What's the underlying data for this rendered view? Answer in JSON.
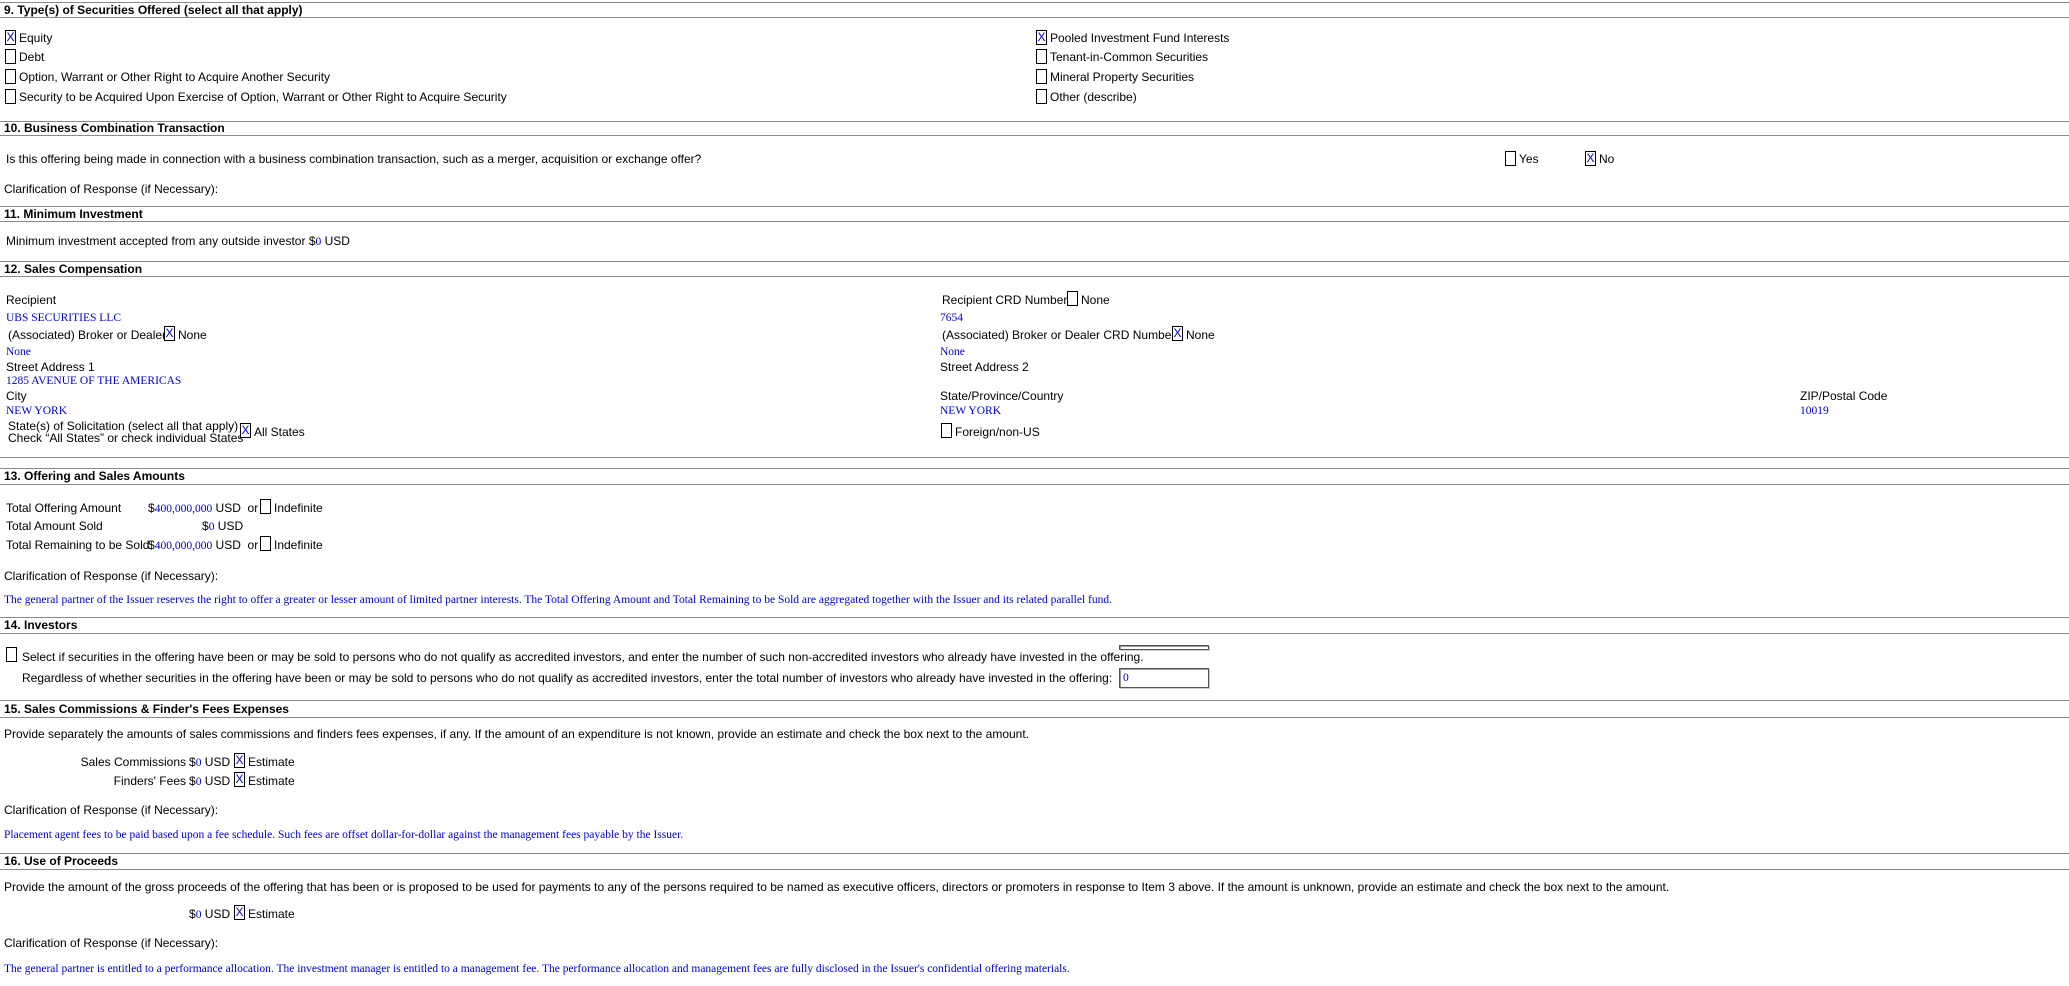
{
  "s9": {
    "heading": "9. Type(s) of Securities Offered (select all that apply)",
    "items": [
      {
        "label": "Equity",
        "mark": "X"
      },
      {
        "label": "Debt",
        "mark": ""
      },
      {
        "label": "Option, Warrant or Other Right to Acquire Another Security",
        "mark": ""
      },
      {
        "label": "Security to be Acquired Upon Exercise of Option, Warrant or Other Right to Acquire Security",
        "mark": ""
      },
      {
        "label": "Pooled Investment Fund Interests",
        "mark": "X"
      },
      {
        "label": "Tenant-in-Common Securities",
        "mark": ""
      },
      {
        "label": "Mineral Property Securities",
        "mark": ""
      },
      {
        "label": "Other (describe)",
        "mark": ""
      }
    ]
  },
  "s10": {
    "heading": "10. Business Combination Transaction",
    "question": "Is this offering being made in connection with a business combination transaction, such as a merger, acquisition or exchange offer?",
    "yes_label": "Yes",
    "yes_mark": "",
    "no_label": "No",
    "no_mark": "X",
    "clarification_label": "Clarification of Response (if Necessary):"
  },
  "s11": {
    "heading": "11. Minimum Investment",
    "label": "Minimum investment accepted from any outside investor",
    "currency_symbol": "$",
    "value": "0",
    "unit": "USD"
  },
  "s12": {
    "heading": "12. Sales Compensation",
    "recipient_label": "Recipient",
    "recipient_value": "UBS SECURITIES LLC",
    "crd_label": "Recipient CRD Number",
    "crd_none_mark": "",
    "none_label": "None",
    "crd_value": "7654",
    "bd_label": "(Associated) Broker or Dealer",
    "bd_none_mark": "X",
    "bd_value": "None",
    "bd_crd_label": "(Associated) Broker or Dealer CRD Number",
    "bd_crd_none_mark": "X",
    "bd_crd_value": "None",
    "street1_label": "Street Address 1",
    "street1_value": "1285 AVENUE OF THE AMERICAS",
    "street2_label": "Street Address 2",
    "city_label": "City",
    "city_value": "NEW YORK",
    "state_label": "State/Province/Country",
    "state_value": "NEW YORK",
    "zip_label": "ZIP/Postal Code",
    "zip_value": "10019",
    "solicitation_label1": "State(s) of Solicitation (select all that apply)",
    "solicitation_label2": "Check “All States” or check individual States",
    "all_states_label": "All States",
    "all_states_mark": "X",
    "foreign_label": "Foreign/non-US",
    "foreign_mark": ""
  },
  "s13": {
    "heading": "13. Offering and Sales Amounts",
    "total_offering_label": "Total Offering Amount",
    "total_offering_value": "400,000,000",
    "total_sold_label": "Total Amount Sold",
    "total_sold_value": "0",
    "total_remaining_label": "Total Remaining to be Sold",
    "total_remaining_value": "400,000,000",
    "currency_symbol": "$",
    "unit": "USD",
    "or_label": "or",
    "indefinite_label": "Indefinite",
    "clarification_label": "Clarification of Response (if Necessary):",
    "clarification_text": "The general partner of the Issuer reserves the right to offer a greater or lesser amount of limited partner interests. The Total Offering Amount and Total Remaining to be Sold are aggregated together with the Issuer and its related parallel fund."
  },
  "s14": {
    "heading": "14. Investors",
    "non_accredited_label": "Select if securities in the offering have been or may be sold to persons who do not qualify as accredited investors, and enter the number of such non-accredited investors who already have invested in the offering.",
    "total_label": "Regardless of whether securities in the offering have been or may be sold to persons who do not qualify as accredited investors, enter the total number of investors who already have invested in the offering:",
    "total_value": "0"
  },
  "s15": {
    "heading": "15. Sales Commissions & Finder's Fees Expenses",
    "intro": "Provide separately the amounts of sales commissions and finders fees expenses, if any. If the amount of an expenditure is not known, provide an estimate and check the box next to the amount.",
    "sales_label": "Sales Commissions",
    "sales_value": "0",
    "finders_label": "Finders' Fees",
    "finders_value": "0",
    "currency_symbol": "$",
    "unit": "USD",
    "estimate_label": "Estimate",
    "estimate_mark": "X",
    "clarification_label": "Clarification of Response (if Necessary):",
    "clarification_text": "Placement agent fees to be paid based upon a fee schedule. Such fees are offset dollar-for-dollar against the management fees payable by the Issuer."
  },
  "s16": {
    "heading": "16. Use of Proceeds",
    "intro": "Provide the amount of the gross proceeds of the offering that has been or is proposed to be used for payments to any of the persons required to be named as executive officers, directors or promoters in response to Item 3 above. If the amount is unknown, provide an estimate and check the box next to the amount.",
    "currency_symbol": "$",
    "value": "0",
    "unit": "USD",
    "estimate_label": "Estimate",
    "estimate_mark": "X",
    "clarification_label": "Clarification of Response (if Necessary):",
    "clarification_text": "The general partner is entitled to a performance allocation. The investment manager is entitled to a management fee. The performance allocation and management fees are fully disclosed in the Issuer's confidential offering materials."
  }
}
